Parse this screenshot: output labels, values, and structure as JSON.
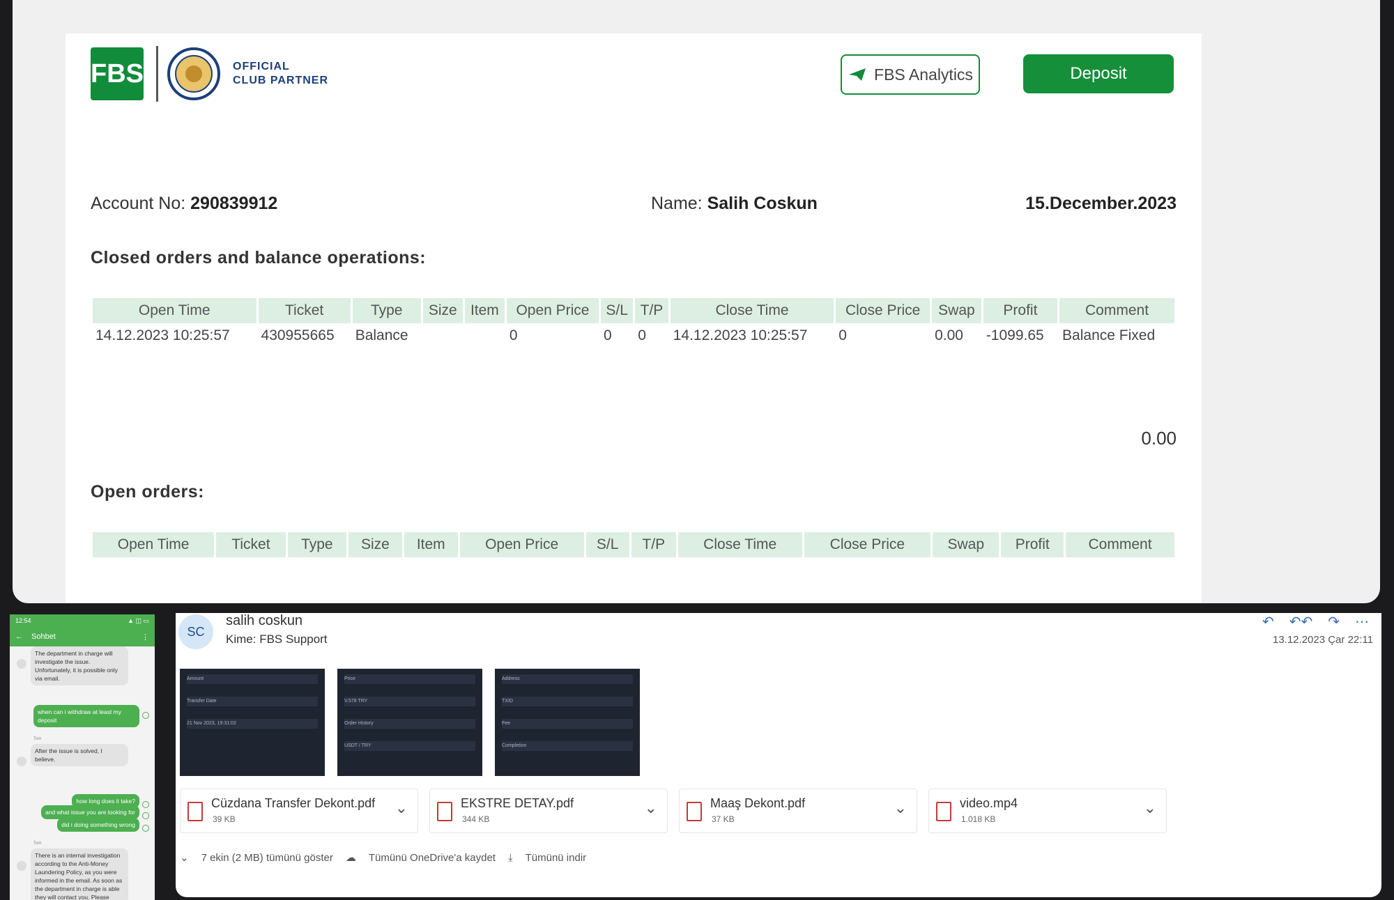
{
  "statement": {
    "logo": "FBS",
    "partner_line1": "OFFICIAL",
    "partner_line2": "CLUB PARTNER",
    "analytics_button": "FBS Analytics",
    "deposit_button": "Deposit",
    "account_label": "Account No:",
    "account_no": "290839912",
    "name_label": "Name:",
    "name": "Salih Coskun",
    "date": "15.December.2023",
    "closed_title": "Closed orders and balance operations:",
    "open_title": "Open orders:",
    "total": "0.00",
    "columns": [
      "Open Time",
      "Ticket",
      "Type",
      "Size",
      "Item",
      "Open Price",
      "S/L",
      "T/P",
      "Close Time",
      "Close Price",
      "Swap",
      "Profit",
      "Comment"
    ],
    "closed_rows": [
      [
        "14.12.2023 10:25:57",
        "430955665",
        "Balance",
        "",
        "",
        "0",
        "0",
        "0",
        "14.12.2023 10:25:57",
        "0",
        "0.00",
        "-1099.65",
        "Balance Fixed"
      ]
    ]
  },
  "phone": {
    "time": "12:54",
    "status_icons": "▲ ◫ ▭",
    "back": "←",
    "title": "Sohbet",
    "menu": "⋮",
    "messages": [
      {
        "from": "in",
        "text": "The department in charge will investigate the issue. Unfortunately, it is possible only via email."
      },
      {
        "from": "out",
        "text": "when can i withdraw at least my deposit"
      },
      {
        "from": "in",
        "sender": "Tom",
        "text": "After the issue is solved, I believe."
      },
      {
        "from": "out",
        "text": "how long does it take?"
      },
      {
        "from": "out",
        "text": "and what issue you are looking for"
      },
      {
        "from": "out",
        "text": "did i doing something wrong"
      },
      {
        "from": "in",
        "sender": "Tom",
        "text": "There is an internal investigation according to the Anti-Money Laundering Policy, as you were informed in the email. As soon as the department in charge is able they will contact you. Please kindly wait."
      }
    ]
  },
  "email": {
    "avatar": "SC",
    "sender": "salih coskun",
    "to_label": "Kime:",
    "to": "FBS Support",
    "date": "13.12.2023 Çar 22:11",
    "actions": [
      "↶",
      "↶↶",
      "↷",
      "⋯"
    ],
    "attachments": [
      {
        "name": "Cüzdana Transfer Dekont.pdf",
        "size": "39 KB",
        "icon": "pdf-icon"
      },
      {
        "name": "EKSTRE DETAY.pdf",
        "size": "344 KB",
        "icon": "pdf-icon"
      },
      {
        "name": "Maaş Dekont.pdf",
        "size": "37 KB",
        "icon": "pdf-icon"
      },
      {
        "name": "video.mp4",
        "size": "1.018 KB",
        "icon": "video-icon"
      }
    ],
    "show_all": "7 ekin (2 MB) tümünü göster",
    "save_onedrive": "Tümünü OneDrive'a kaydet",
    "download_all": "Tümünü indir"
  },
  "thumbnails": [
    {
      "lines": [
        "Amount",
        "Transfer Date",
        "21 Nov 2023, 19:31:02"
      ]
    },
    {
      "lines": [
        "Price",
        "V.578 TRY",
        "Order History",
        "USDT / TRY"
      ]
    },
    {
      "lines": [
        "Address",
        "TXID",
        "Fee",
        "Completion"
      ]
    }
  ]
}
